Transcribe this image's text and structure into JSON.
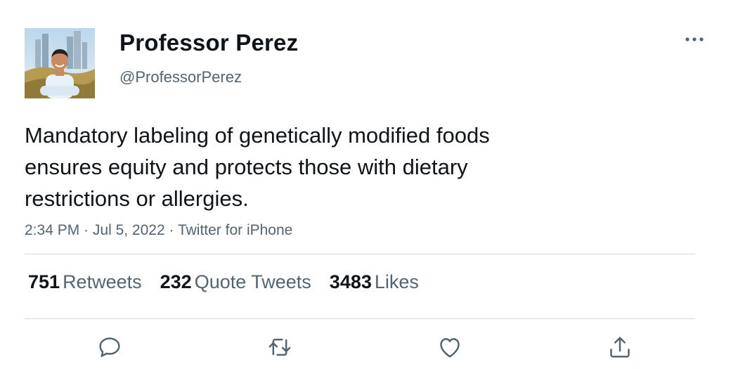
{
  "author": {
    "display_name": "Professor Perez",
    "handle": "@ProfessorPerez",
    "avatar_icon": "avatar-photo"
  },
  "tweet": {
    "text": "Mandatory labeling of genetically modified foods\nensures equity and protects those with dietary\nrestrictions or allergies.",
    "time": "2:34 PM",
    "date": "Jul 5, 2022",
    "source": "Twitter for iPhone",
    "separator": " · "
  },
  "stats": {
    "retweets_count": "751",
    "retweets_label": "Retweets",
    "quotes_count": "232",
    "quotes_label": "Quote Tweets",
    "likes_count": "3483",
    "likes_label": "Likes"
  },
  "actions": {
    "reply_icon": "reply-icon",
    "retweet_icon": "retweet-icon",
    "like_icon": "heart-icon",
    "share_icon": "share-icon"
  },
  "colors": {
    "text_primary": "#0f1419",
    "text_secondary": "#536471",
    "divider": "#cfd9de",
    "icon": "#536471"
  }
}
